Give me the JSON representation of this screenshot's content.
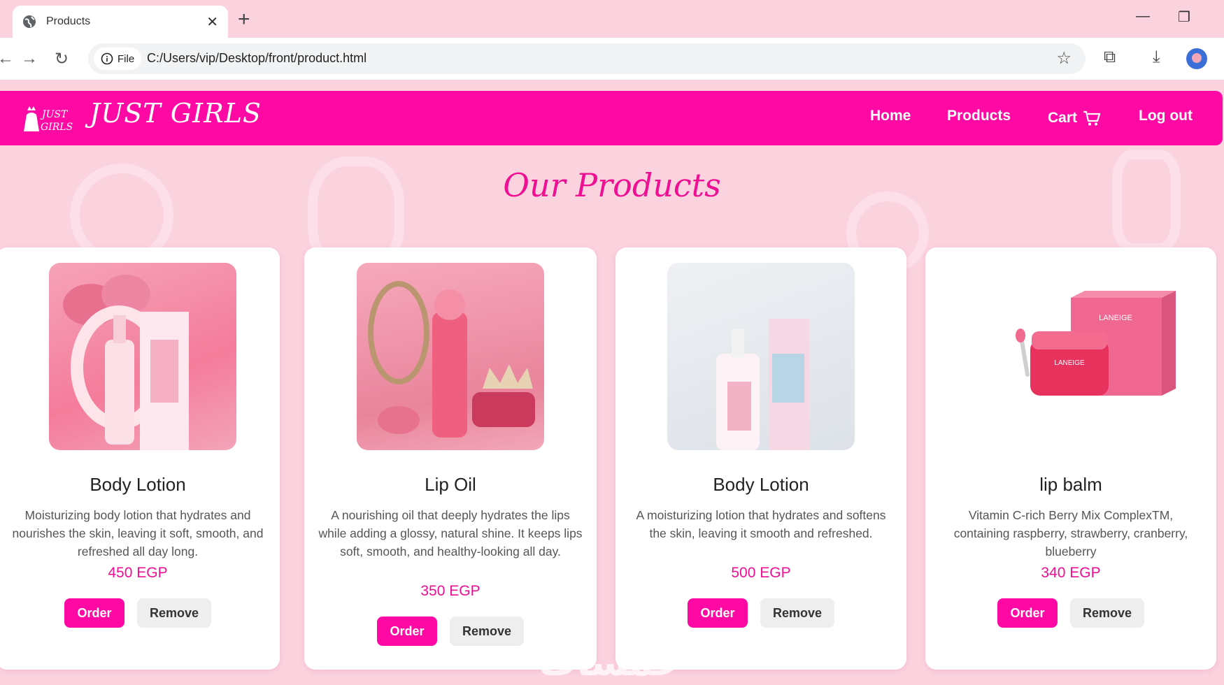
{
  "browser": {
    "tab_title": "Products",
    "tab_close": "✕",
    "new_tab": "+",
    "site_chip": "File",
    "url": "C:/Users/vip/Desktop/front/product.html"
  },
  "site": {
    "logo_text_1": "JUST",
    "logo_text_2": "GIRLS",
    "brand": "JUST GIRLS",
    "nav": {
      "home": "Home",
      "products": "Products",
      "cart": "Cart",
      "logout": "Log out"
    },
    "section_title": "Our Products",
    "accent_color": "#ff09a4",
    "price_color": "#ef0f93"
  },
  "products": [
    {
      "name": "Body Lotion",
      "description": "Moisturizing body lotion that hydrates and nourishes the skin, leaving it soft, smooth, and refreshed all day long.",
      "price": "450 EGP",
      "order_label": "Order",
      "remove_label": "Remove"
    },
    {
      "name": "Lip Oil",
      "description": "A nourishing oil that deeply hydrates the lips while adding a glossy, natural shine. It keeps lips soft, smooth, and healthy-looking all day.",
      "price": "350 EGP",
      "order_label": "Order",
      "remove_label": "Remove"
    },
    {
      "name": "Body Lotion",
      "description": "A moisturizing lotion that hydrates and softens the skin, leaving it smooth and refreshed.",
      "price": "500 EGP",
      "order_label": "Order",
      "remove_label": "Remove"
    },
    {
      "name": "lip balm",
      "description": "Vitamin C-rich Berry Mix ComplexTM, containing raspberry, strawberry, cranberry, blueberry",
      "price": "340 EGP",
      "order_label": "Order",
      "remove_label": "Remove",
      "image_text": "LANEIGE"
    }
  ],
  "watermark": "خمسات"
}
